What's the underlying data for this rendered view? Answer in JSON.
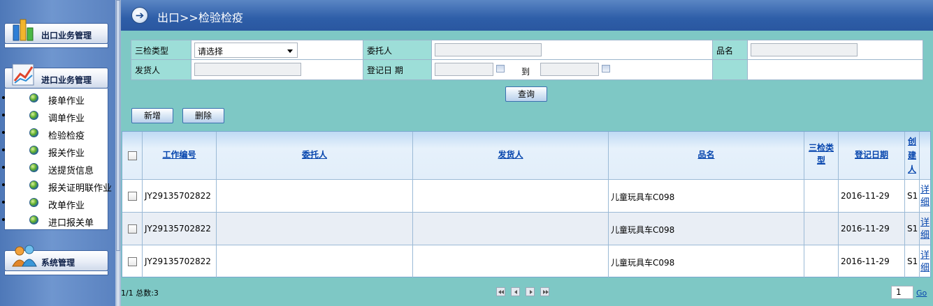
{
  "sidebar": {
    "export_header": "出口业务管理",
    "import_header": "进口业务管理",
    "system_header": "系统管理",
    "import_items": [
      {
        "label": "接单作业"
      },
      {
        "label": "调单作业"
      },
      {
        "label": "检验检疫"
      },
      {
        "label": "报关作业"
      },
      {
        "label": "送提货信息"
      },
      {
        "label": "报关证明联作业"
      },
      {
        "label": "改单作业"
      },
      {
        "label": "进口报关单"
      }
    ]
  },
  "header": {
    "title": "出口>>检验检疫",
    "arrow_icon": "arrow-right-icon"
  },
  "search": {
    "inspection_type_label": "三检类型",
    "inspection_type_value": "请选择",
    "consignor_label": "委托人",
    "consignor_value": "",
    "product_label": "品名",
    "product_value": "",
    "shipper_label": "发货人",
    "shipper_value": "",
    "register_date_label": "登记日 期",
    "date_from": "",
    "date_to_label": "到",
    "date_to": "",
    "query_button": "查询"
  },
  "toolbar": {
    "add_button": "新增",
    "delete_button": "删除"
  },
  "table": {
    "headers": {
      "work_no": "工作编号",
      "consignor": "委托人",
      "shipper": "发货人",
      "product": "品名",
      "inspection_type_line1": "三检类",
      "inspection_type_line2": "型",
      "register_date": "登记日期",
      "creator_line1": "创",
      "creator_line2": "建",
      "creator_line3": "人"
    },
    "rows": [
      {
        "work_no": "JY29135702822",
        "consignor": "",
        "shipper": "",
        "product": "儿童玩具车C098",
        "inspection_type": "",
        "register_date": "2016-11-29",
        "creator": "S1",
        "detail_line1": "详",
        "detail_line2": "细"
      },
      {
        "work_no": "JY29135702822",
        "consignor": "",
        "shipper": "",
        "product": "儿童玩具车C098",
        "inspection_type": "",
        "register_date": "2016-11-29",
        "creator": "S1",
        "detail_line1": "详",
        "detail_line2": "细"
      },
      {
        "work_no": "JY29135702822",
        "consignor": "",
        "shipper": "",
        "product": "儿童玩具车C098",
        "inspection_type": "",
        "register_date": "2016-11-29",
        "creator": "S1",
        "detail_line1": "详",
        "detail_line2": "细"
      }
    ]
  },
  "pager": {
    "summary": "1/1 总数:3",
    "page_value": "1",
    "go_label": "Go"
  }
}
